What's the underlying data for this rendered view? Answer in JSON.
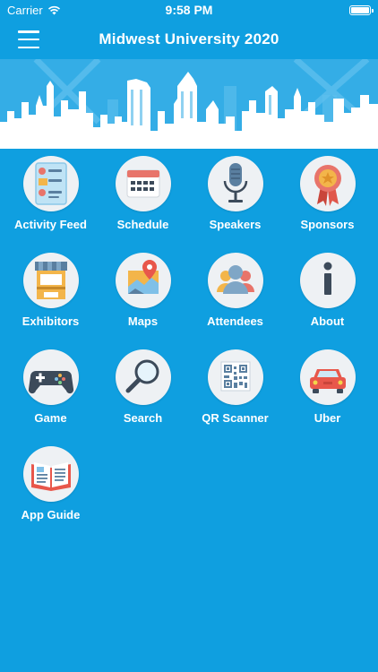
{
  "status": {
    "carrier": "Carrier",
    "time": "9:58 PM"
  },
  "nav": {
    "title": "Midwest University 2020"
  },
  "colors": {
    "background": "#0f9fe0",
    "banner": "#34ade6",
    "tile_bg": "#eef1f4"
  },
  "tiles": [
    {
      "label": "Activity Feed",
      "icon": "activity-feed-icon"
    },
    {
      "label": "Schedule",
      "icon": "calendar-icon"
    },
    {
      "label": "Speakers",
      "icon": "microphone-icon"
    },
    {
      "label": "Sponsors",
      "icon": "ribbon-award-icon"
    },
    {
      "label": "Exhibitors",
      "icon": "booth-icon"
    },
    {
      "label": "Maps",
      "icon": "map-pin-icon"
    },
    {
      "label": "Attendees",
      "icon": "people-icon"
    },
    {
      "label": "About",
      "icon": "info-icon"
    },
    {
      "label": "Game",
      "icon": "gamepad-icon"
    },
    {
      "label": "Search",
      "icon": "magnifier-icon"
    },
    {
      "label": "QR Scanner",
      "icon": "qr-code-icon"
    },
    {
      "label": "Uber",
      "icon": "car-icon"
    },
    {
      "label": "App Guide",
      "icon": "open-book-icon"
    }
  ]
}
